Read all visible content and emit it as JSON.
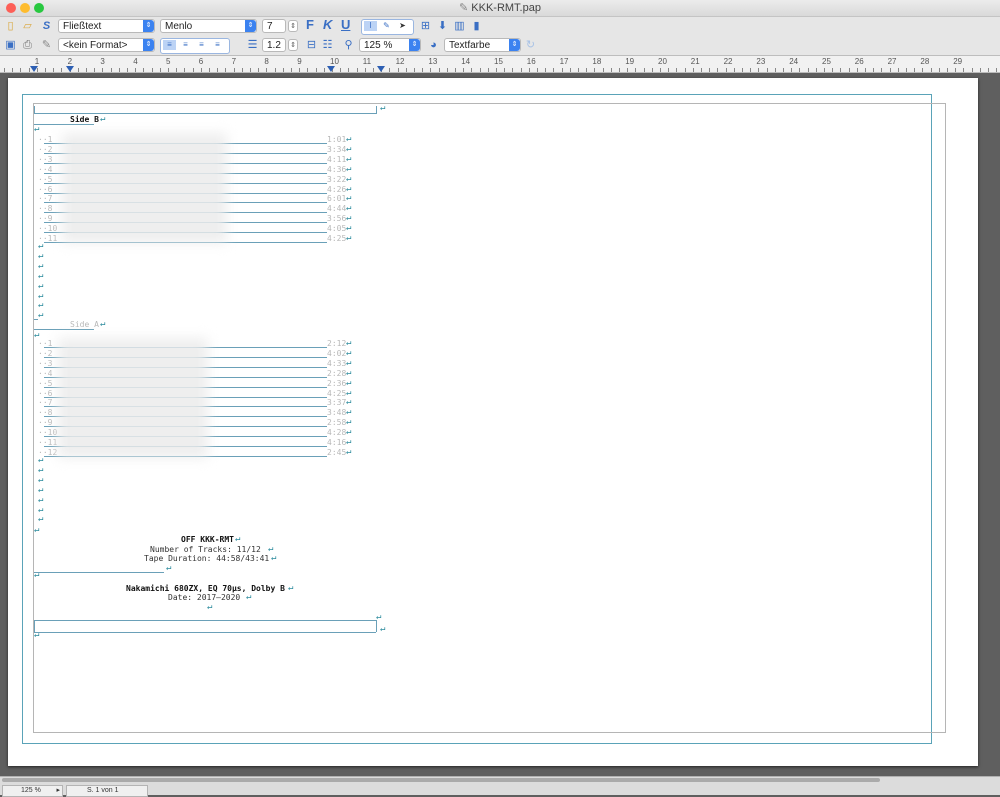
{
  "window": {
    "title": "KKK-RMT.pap",
    "file_icon": "document-pen-icon",
    "traffic_lights": {
      "close": "#fd5f57",
      "minimize": "#febc2e",
      "zoom": "#28c840"
    }
  },
  "toolbar1": {
    "paragraph_style": "Fließtext",
    "font": "Menlo",
    "font_size": "7",
    "bold_label": "F",
    "italic_label": "K",
    "underline_label": "U"
  },
  "toolbar2": {
    "char_format": "<kein Format>",
    "line_spacing": "1.2",
    "zoom": "125 %",
    "color_menu": "Textfarbe"
  },
  "ruler": {
    "numbers": [
      "1",
      "2",
      "3",
      "4",
      "5",
      "6",
      "7",
      "8",
      "9",
      "10",
      "11",
      "12",
      "13",
      "14",
      "15",
      "16",
      "17",
      "18",
      "19",
      "20",
      "21",
      "22",
      "23",
      "24",
      "25",
      "26",
      "27",
      "28",
      "29"
    ]
  },
  "document": {
    "accent_color": "#2a8a9c",
    "side_b": {
      "heading": "Side B",
      "tracks": [
        {
          "num": "1",
          "time": "1:01"
        },
        {
          "num": "2",
          "time": "3:34"
        },
        {
          "num": "3",
          "time": "4:11"
        },
        {
          "num": "4",
          "time": "4:36"
        },
        {
          "num": "5",
          "time": "3:22"
        },
        {
          "num": "6",
          "time": "4:26"
        },
        {
          "num": "7",
          "time": "6:01"
        },
        {
          "num": "8",
          "time": "4:44"
        },
        {
          "num": "9",
          "time": "3:56"
        },
        {
          "num": "10",
          "time": "4:05"
        },
        {
          "num": "11",
          "time": "4:25"
        }
      ]
    },
    "side_a": {
      "heading": "Side A",
      "tracks": [
        {
          "num": "1",
          "time": "2:12"
        },
        {
          "num": "2",
          "time": "4:02"
        },
        {
          "num": "3",
          "time": "4:33"
        },
        {
          "num": "4",
          "time": "2:28"
        },
        {
          "num": "5",
          "time": "2:36"
        },
        {
          "num": "6",
          "time": "4:25"
        },
        {
          "num": "7",
          "time": "3:37"
        },
        {
          "num": "8",
          "time": "3:48"
        },
        {
          "num": "9",
          "time": "2:58"
        },
        {
          "num": "10",
          "time": "4:28"
        },
        {
          "num": "11",
          "time": "4:16"
        },
        {
          "num": "12",
          "time": "2:45"
        }
      ]
    },
    "footer": {
      "line1": "OFF KKK-RMT",
      "line2": "Number of Tracks: 11/12",
      "line3": "Tape Duration: 44:58/43:41",
      "line4": "Nakamichi 680ZX, EQ 70µs, Dolby B",
      "line5": "Date: 2017–2020"
    }
  },
  "statusbar": {
    "zoom": "125 %",
    "page_info": "S. 1 von 1"
  }
}
